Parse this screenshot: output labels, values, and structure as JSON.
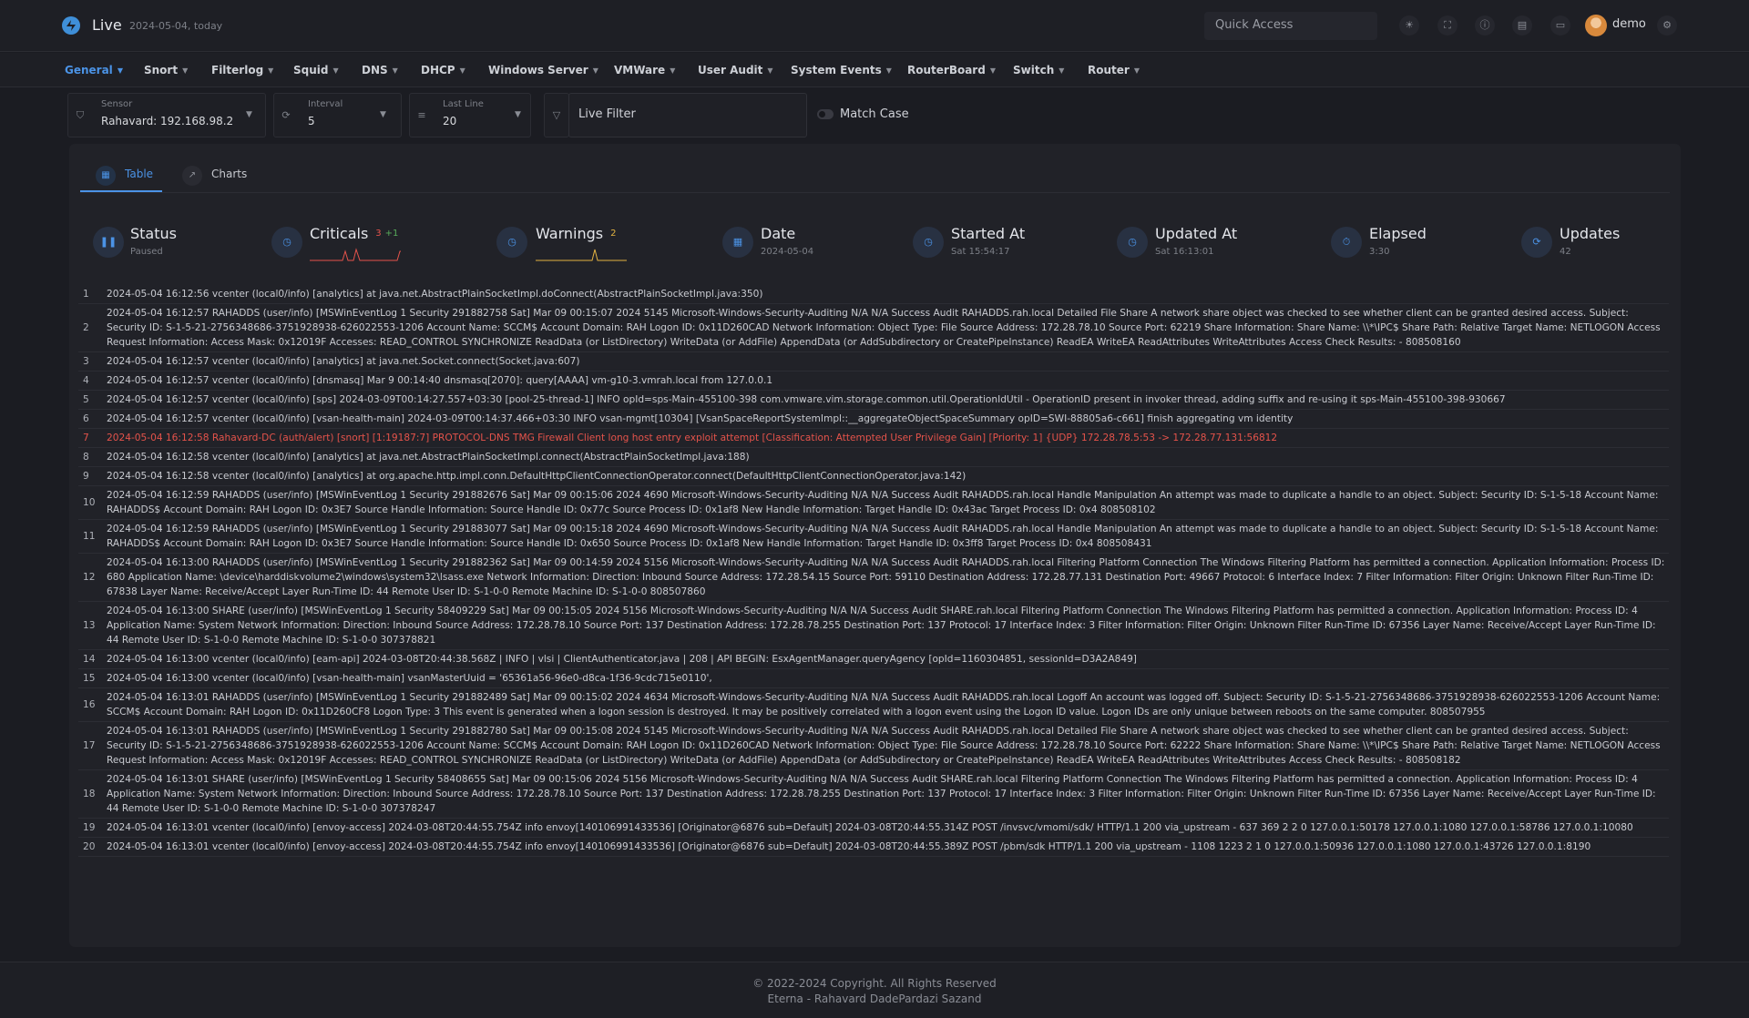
{
  "header": {
    "app_title": "Live",
    "app_subtitle": "2024-05-04, today",
    "quick_access_placeholder": "Quick Access",
    "username": "demo"
  },
  "nav": {
    "items": [
      {
        "label": "General",
        "active": true
      },
      {
        "label": "Snort"
      },
      {
        "label": "Filterlog"
      },
      {
        "label": "Squid"
      },
      {
        "label": "DNS"
      },
      {
        "label": "DHCP"
      },
      {
        "label": "Windows Server"
      },
      {
        "label": "VMWare"
      },
      {
        "label": "User Audit"
      },
      {
        "label": "System Events"
      },
      {
        "label": "RouterBoard"
      },
      {
        "label": "Switch"
      },
      {
        "label": "Router"
      }
    ]
  },
  "filters": {
    "sensor": {
      "label": "Sensor",
      "value": "Rahavard: 192.168.98.2"
    },
    "interval": {
      "label": "Interval",
      "value": "5"
    },
    "last_line": {
      "label": "Last Line",
      "value": "20"
    },
    "live_filter_placeholder": "Live Filter",
    "match_case_label": "Match Case",
    "match_case_checked": false
  },
  "tabs": [
    {
      "label": "Table",
      "active": true
    },
    {
      "label": "Charts",
      "active": false
    }
  ],
  "stats": {
    "status": {
      "title": "Status",
      "value": "Paused"
    },
    "criticals": {
      "title": "Criticals",
      "count": "3",
      "delta": "+1"
    },
    "warnings": {
      "title": "Warnings",
      "count": "2"
    },
    "date": {
      "title": "Date",
      "value": "2024-05-04"
    },
    "started_at": {
      "title": "Started At",
      "value": "Sat 15:54:17"
    },
    "updated_at": {
      "title": "Updated At",
      "value": "Sat 16:13:01"
    },
    "elapsed": {
      "title": "Elapsed",
      "value": "3:30"
    },
    "updates": {
      "title": "Updates",
      "value": "42"
    }
  },
  "colors": {
    "accent": "#4b93e6",
    "critical": "#e5534b",
    "warning": "#e3b341",
    "positive": "#57ab5a"
  },
  "log_rows": [
    {
      "n": "1",
      "text": "2024-05-04 16:12:56 vcenter (local0/info) [analytics] at java.net.AbstractPlainSocketImpl.doConnect(AbstractPlainSocketImpl.java:350)"
    },
    {
      "n": "2",
      "text": "2024-05-04 16:12:57 RAHADDS (user/info) [MSWinEventLog 1 Security 291882758 Sat] Mar 09 00:15:07 2024 5145 Microsoft-Windows-Security-Auditing N/A N/A Success Audit RAHADDS.rah.local Detailed File Share A network share object was checked to see whether client can be granted desired access. Subject: Security ID: S-1-5-21-2756348686-3751928938-626022553-1206 Account Name: SCCM$ Account Domain: RAH Logon ID: 0x11D260CAD Network Information: Object Type: File Source Address: 172.28.78.10 Source Port: 62219 Share Information: Share Name: \\\\*\\IPC$ Share Path: Relative Target Name: NETLOGON Access Request Information: Access Mask: 0x12019F Accesses: READ_CONTROL SYNCHRONIZE ReadData (or ListDirectory) WriteData (or AddFile) AppendData (or AddSubdirectory or CreatePipeInstance) ReadEA WriteEA ReadAttributes WriteAttributes Access Check Results: - 808508160"
    },
    {
      "n": "3",
      "text": "2024-05-04 16:12:57 vcenter (local0/info) [analytics] at java.net.Socket.connect(Socket.java:607)"
    },
    {
      "n": "4",
      "text": "2024-05-04 16:12:57 vcenter (local0/info) [dnsmasq] Mar 9 00:14:40 dnsmasq[2070]: query[AAAA] vm-g10-3.vmrah.local from 127.0.0.1"
    },
    {
      "n": "5",
      "text": "2024-05-04 16:12:57 vcenter (local0/info) [sps] 2024-03-09T00:14:27.557+03:30 [pool-25-thread-1] INFO opId=sps-Main-455100-398 com.vmware.vim.storage.common.util.OperationIdUtil - OperationID present in invoker thread, adding suffix and re-using it sps-Main-455100-398-930667"
    },
    {
      "n": "6",
      "text": "2024-05-04 16:12:57 vcenter (local0/info) [vsan-health-main] 2024-03-09T00:14:37.466+03:30 INFO vsan-mgmt[10304] [VsanSpaceReportSystemImpl::__aggregateObjectSpaceSummary opID=SWI-88805a6-c661] finish aggregating vm identity"
    },
    {
      "n": "7",
      "alert": true,
      "text": "2024-05-04 16:12:58 Rahavard-DC (auth/alert) [snort] [1:19187:7] PROTOCOL-DNS TMG Firewall Client long host entry exploit attempt [Classification: Attempted User Privilege Gain] [Priority: 1] {UDP} 172.28.78.5:53 -> 172.28.77.131:56812"
    },
    {
      "n": "8",
      "text": "2024-05-04 16:12:58 vcenter (local0/info) [analytics] at java.net.AbstractPlainSocketImpl.connect(AbstractPlainSocketImpl.java:188)"
    },
    {
      "n": "9",
      "text": "2024-05-04 16:12:58 vcenter (local0/info) [analytics] at org.apache.http.impl.conn.DefaultHttpClientConnectionOperator.connect(DefaultHttpClientConnectionOperator.java:142)"
    },
    {
      "n": "10",
      "text": "2024-05-04 16:12:59 RAHADDS (user/info) [MSWinEventLog 1 Security 291882676 Sat] Mar 09 00:15:06 2024 4690 Microsoft-Windows-Security-Auditing N/A N/A Success Audit RAHADDS.rah.local Handle Manipulation An attempt was made to duplicate a handle to an object. Subject: Security ID: S-1-5-18 Account Name: RAHADDS$ Account Domain: RAH Logon ID: 0x3E7 Source Handle Information: Source Handle ID: 0x77c Source Process ID: 0x1af8 New Handle Information: Target Handle ID: 0x43ac Target Process ID: 0x4 808508102"
    },
    {
      "n": "11",
      "text": "2024-05-04 16:12:59 RAHADDS (user/info) [MSWinEventLog 1 Security 291883077 Sat] Mar 09 00:15:18 2024 4690 Microsoft-Windows-Security-Auditing N/A N/A Success Audit RAHADDS.rah.local Handle Manipulation An attempt was made to duplicate a handle to an object. Subject: Security ID: S-1-5-18 Account Name: RAHADDS$ Account Domain: RAH Logon ID: 0x3E7 Source Handle Information: Source Handle ID: 0x650 Source Process ID: 0x1af8 New Handle Information: Target Handle ID: 0x3ff8 Target Process ID: 0x4 808508431"
    },
    {
      "n": "12",
      "text": "2024-05-04 16:13:00 RAHADDS (user/info) [MSWinEventLog 1 Security 291882362 Sat] Mar 09 00:14:59 2024 5156 Microsoft-Windows-Security-Auditing N/A N/A Success Audit RAHADDS.rah.local Filtering Platform Connection The Windows Filtering Platform has permitted a connection. Application Information: Process ID: 680 Application Name: \\device\\harddiskvolume2\\windows\\system32\\lsass.exe Network Information: Direction: Inbound Source Address: 172.28.54.15 Source Port: 59110 Destination Address: 172.28.77.131 Destination Port: 49667 Protocol: 6 Interface Index: 7 Filter Information: Filter Origin: Unknown Filter Run-Time ID: 67838 Layer Name: Receive/Accept Layer Run-Time ID: 44 Remote User ID: S-1-0-0 Remote Machine ID: S-1-0-0 808507860"
    },
    {
      "n": "13",
      "text": "2024-05-04 16:13:00 SHARE (user/info) [MSWinEventLog 1 Security 58409229 Sat] Mar 09 00:15:05 2024 5156 Microsoft-Windows-Security-Auditing N/A N/A Success Audit SHARE.rah.local Filtering Platform Connection The Windows Filtering Platform has permitted a connection. Application Information: Process ID: 4 Application Name: System Network Information: Direction: Inbound Source Address: 172.28.78.10 Source Port: 137 Destination Address: 172.28.78.255 Destination Port: 137 Protocol: 17 Interface Index: 3 Filter Information: Filter Origin: Unknown Filter Run-Time ID: 67356 Layer Name: Receive/Accept Layer Run-Time ID: 44 Remote User ID: S-1-0-0 Remote Machine ID: S-1-0-0 307378821"
    },
    {
      "n": "14",
      "text": "2024-05-04 16:13:00 vcenter (local0/info) [eam-api] 2024-03-08T20:44:38.568Z | INFO | vlsi | ClientAuthenticator.java | 208 | API BEGIN: EsxAgentManager.queryAgency [opId=1160304851, sessionId=D3A2A849]"
    },
    {
      "n": "15",
      "text": "2024-05-04 16:13:00 vcenter (local0/info) [vsan-health-main] vsanMasterUuid = '65361a56-96e0-d8ca-1f36-9cdc715e0110',"
    },
    {
      "n": "16",
      "text": "2024-05-04 16:13:01 RAHADDS (user/info) [MSWinEventLog 1 Security 291882489 Sat] Mar 09 00:15:02 2024 4634 Microsoft-Windows-Security-Auditing N/A N/A Success Audit RAHADDS.rah.local Logoff An account was logged off. Subject: Security ID: S-1-5-21-2756348686-3751928938-626022553-1206 Account Name: SCCM$ Account Domain: RAH Logon ID: 0x11D260CF8 Logon Type: 3 This event is generated when a logon session is destroyed. It may be positively correlated with a logon event using the Logon ID value. Logon IDs are only unique between reboots on the same computer. 808507955"
    },
    {
      "n": "17",
      "text": "2024-05-04 16:13:01 RAHADDS (user/info) [MSWinEventLog 1 Security 291882780 Sat] Mar 09 00:15:08 2024 5145 Microsoft-Windows-Security-Auditing N/A N/A Success Audit RAHADDS.rah.local Detailed File Share A network share object was checked to see whether client can be granted desired access. Subject: Security ID: S-1-5-21-2756348686-3751928938-626022553-1206 Account Name: SCCM$ Account Domain: RAH Logon ID: 0x11D260CAD Network Information: Object Type: File Source Address: 172.28.78.10 Source Port: 62222 Share Information: Share Name: \\\\*\\IPC$ Share Path: Relative Target Name: NETLOGON Access Request Information: Access Mask: 0x12019F Accesses: READ_CONTROL SYNCHRONIZE ReadData (or ListDirectory) WriteData (or AddFile) AppendData (or AddSubdirectory or CreatePipeInstance) ReadEA WriteEA ReadAttributes WriteAttributes Access Check Results: - 808508182"
    },
    {
      "n": "18",
      "text": "2024-05-04 16:13:01 SHARE (user/info) [MSWinEventLog 1 Security 58408655 Sat] Mar 09 00:15:06 2024 5156 Microsoft-Windows-Security-Auditing N/A N/A Success Audit SHARE.rah.local Filtering Platform Connection The Windows Filtering Platform has permitted a connection. Application Information: Process ID: 4 Application Name: System Network Information: Direction: Inbound Source Address: 172.28.78.10 Source Port: 137 Destination Address: 172.28.78.255 Destination Port: 137 Protocol: 17 Interface Index: 3 Filter Information: Filter Origin: Unknown Filter Run-Time ID: 67356 Layer Name: Receive/Accept Layer Run-Time ID: 44 Remote User ID: S-1-0-0 Remote Machine ID: S-1-0-0 307378247"
    },
    {
      "n": "19",
      "text": "2024-05-04 16:13:01 vcenter (local0/info) [envoy-access] 2024-03-08T20:44:55.754Z info envoy[140106991433536] [Originator@6876 sub=Default] 2024-03-08T20:44:55.314Z POST /invsvc/vmomi/sdk/ HTTP/1.1 200 via_upstream - 637 369 2 2 0 127.0.0.1:50178 127.0.0.1:1080 127.0.0.1:58786 127.0.0.1:10080"
    },
    {
      "n": "20",
      "text": "2024-05-04 16:13:01 vcenter (local0/info) [envoy-access] 2024-03-08T20:44:55.754Z info envoy[140106991433536] [Originator@6876 sub=Default] 2024-03-08T20:44:55.389Z POST /pbm/sdk HTTP/1.1 200 via_upstream - 1108 1223 2 1 0 127.0.0.1:50936 127.0.0.1:1080 127.0.0.1:43726 127.0.0.1:8190"
    }
  ],
  "footer": {
    "copyright": "© 2022-2024 Copyright. All Rights Reserved",
    "company": "Eterna - Rahavard DadePardazi Sazand"
  }
}
